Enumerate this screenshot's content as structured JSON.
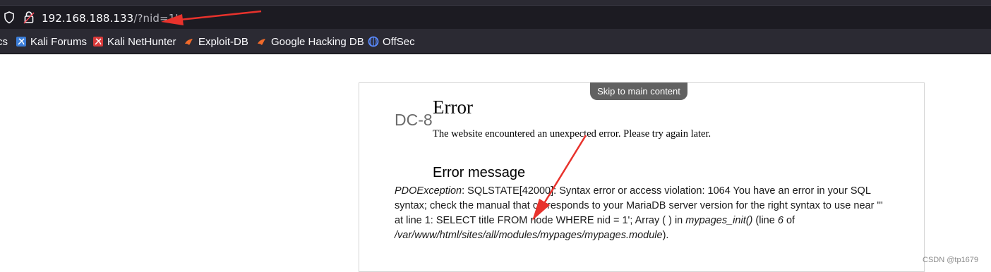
{
  "browser": {
    "url_host": "192.168.188.133",
    "url_path": "/?nid=1'",
    "bookmarks": [
      {
        "label": "cs",
        "icon": "partial-bookmark-icon"
      },
      {
        "label": "Kali Forums",
        "icon": "kali-forums-icon"
      },
      {
        "label": "Kali NetHunter",
        "icon": "kali-nethunter-icon"
      },
      {
        "label": "Exploit-DB",
        "icon": "exploit-db-icon"
      },
      {
        "label": "Google Hacking DB",
        "icon": "ghdb-icon"
      },
      {
        "label": "OffSec",
        "icon": "offsec-icon"
      }
    ]
  },
  "page": {
    "skip_link": "Skip to main content",
    "site_name": "DC-8",
    "error_title": "Error",
    "error_description": "The website encountered an unexpected error. Please try again later.",
    "message_heading": "Error message",
    "message": {
      "exception": "PDOException",
      "text_1": ": SQLSTATE[42000]: Syntax error or access violation: 1064 You have an error in your SQL syntax; check the manual that corresponds to your MariaDB server version for the right syntax to use near ''' at line 1: SELECT title FROM node WHERE nid = 1'; Array ( ) in ",
      "function": "mypages_init()",
      "text_2": " (line ",
      "line": "6",
      "text_3": " of ",
      "file": "/var/www/html/sites/all/modules/mypages/mypages.module",
      "text_4": ")."
    }
  },
  "watermark": "CSDN @tp1679",
  "colors": {
    "annotation_arrow": "#e8322c",
    "chrome_dark": "#1c1b22",
    "toolbar": "#2b2a33"
  }
}
